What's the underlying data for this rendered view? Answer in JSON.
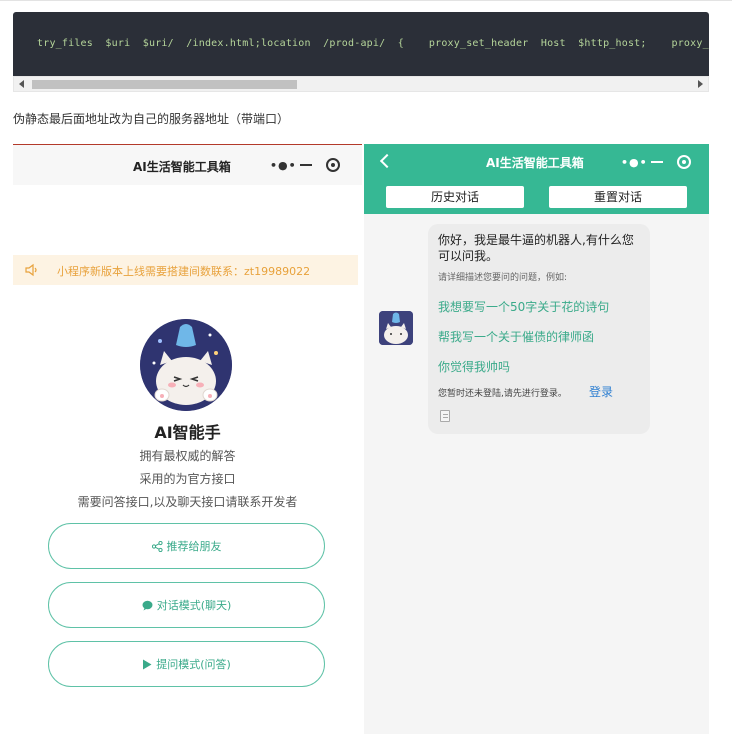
{
  "code": {
    "line": "try_files  $uri  $uri/  /index.html;location  /prod-api/  {    proxy_set_header  Host  $http_host;    proxy_set_header  X-Real-IP  $remote_addr;"
  },
  "caption": "伪静态最后面地址改为自己的服务器地址（带端口）",
  "left_phone": {
    "title": "AI生活智能工具箱",
    "notice": "小程序新版本上线需要搭建间数联系：zt19989022",
    "bot_name": "AI智能手",
    "desc": [
      "拥有最权威的解答",
      "采用的为官方接口",
      "需要问答接口,以及聊天接口请联系开发者"
    ],
    "buttons": [
      {
        "label": "推荐给朋友",
        "icon": "share-icon"
      },
      {
        "label": "对话模式(聊天)",
        "icon": "chat-bubble-icon"
      },
      {
        "label": "提问模式(问答)",
        "icon": "play-icon"
      }
    ]
  },
  "right_phone": {
    "title": "AI生活智能工具箱",
    "tabs": [
      "历史对话",
      "重置对话"
    ],
    "greeting": "你好，我是最牛逼的机器人,有什么您可以问我。",
    "hint": "请详细描述您要问的问题，例如:",
    "questions": [
      "我想要写一个50字关于花的诗句",
      "帮我写一个关于催债的律师函",
      "你觉得我帅吗"
    ],
    "login_note": "您暂时还未登陆,请先进行登录。",
    "login_link": "登录"
  },
  "colors": {
    "accent": "#36b894",
    "accent_text": "#3aaa8a",
    "notice_text": "#e8a23c",
    "link": "#2e7fd1",
    "code_bg": "#2b2f38",
    "code_text": "#b5d59a"
  }
}
